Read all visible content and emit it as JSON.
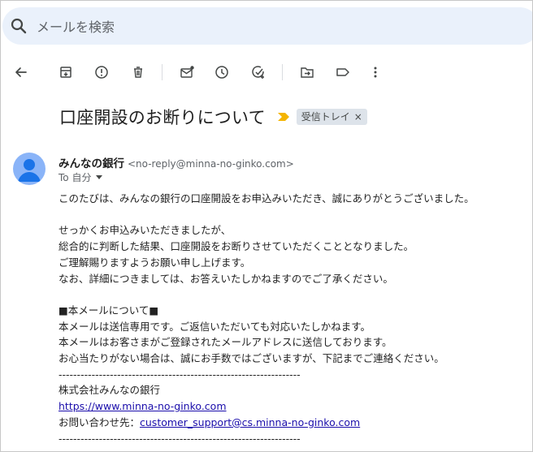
{
  "search": {
    "placeholder": "メールを検索"
  },
  "toolbar": {
    "icons": [
      "back-arrow-icon",
      "archive-icon",
      "report-spam-icon",
      "delete-icon",
      "mark-unread-icon",
      "snooze-icon",
      "add-task-icon",
      "move-to-icon",
      "label-icon",
      "more-icon"
    ]
  },
  "message": {
    "subject": "口座開設のお断りについて",
    "label_chip": "受信トレイ",
    "label_close": "×",
    "sender_name": "みんなの銀行",
    "sender_email": "<no-reply@minna-no-ginko.com>",
    "to_line": "To 自分",
    "body": {
      "l1": "このたびは、みんなの銀行の口座開設をお申込みいただき、誠にありがとうございました。",
      "l2": "せっかくお申込みいただきましたが、",
      "l3": "総合的に判断した結果、口座開設をお断りさせていただくこととなりました。",
      "l4": "ご理解賜りますようお願い申し上げます。",
      "l5": "なお、詳細につきましては、お答えいたしかねますのでご了承ください。",
      "l6": "■本メールについて■",
      "l7": "本メールは送信専用です。ご返信いただいても対応いたしかねます。",
      "l8": "本メールはお客さまがご登録されたメールアドレスに送信しております。",
      "l9": "お心当たりがない場合は、誠にお手数ではございますが、下記までご連絡ください。",
      "divider": "------------------------------------------------------------------",
      "l10": "株式会社みんなの銀行",
      "link_site": "https://www.minna-no-ginko.com",
      "contact_label": "お問い合わせ先：",
      "link_support": "customer_support@cs.minna-no-ginko.com"
    }
  },
  "colors": {
    "search_bg": "#eaf1fb",
    "avatar": "#8ab4f8",
    "link": "#1a0dab",
    "important_marker": "#f4b400"
  }
}
